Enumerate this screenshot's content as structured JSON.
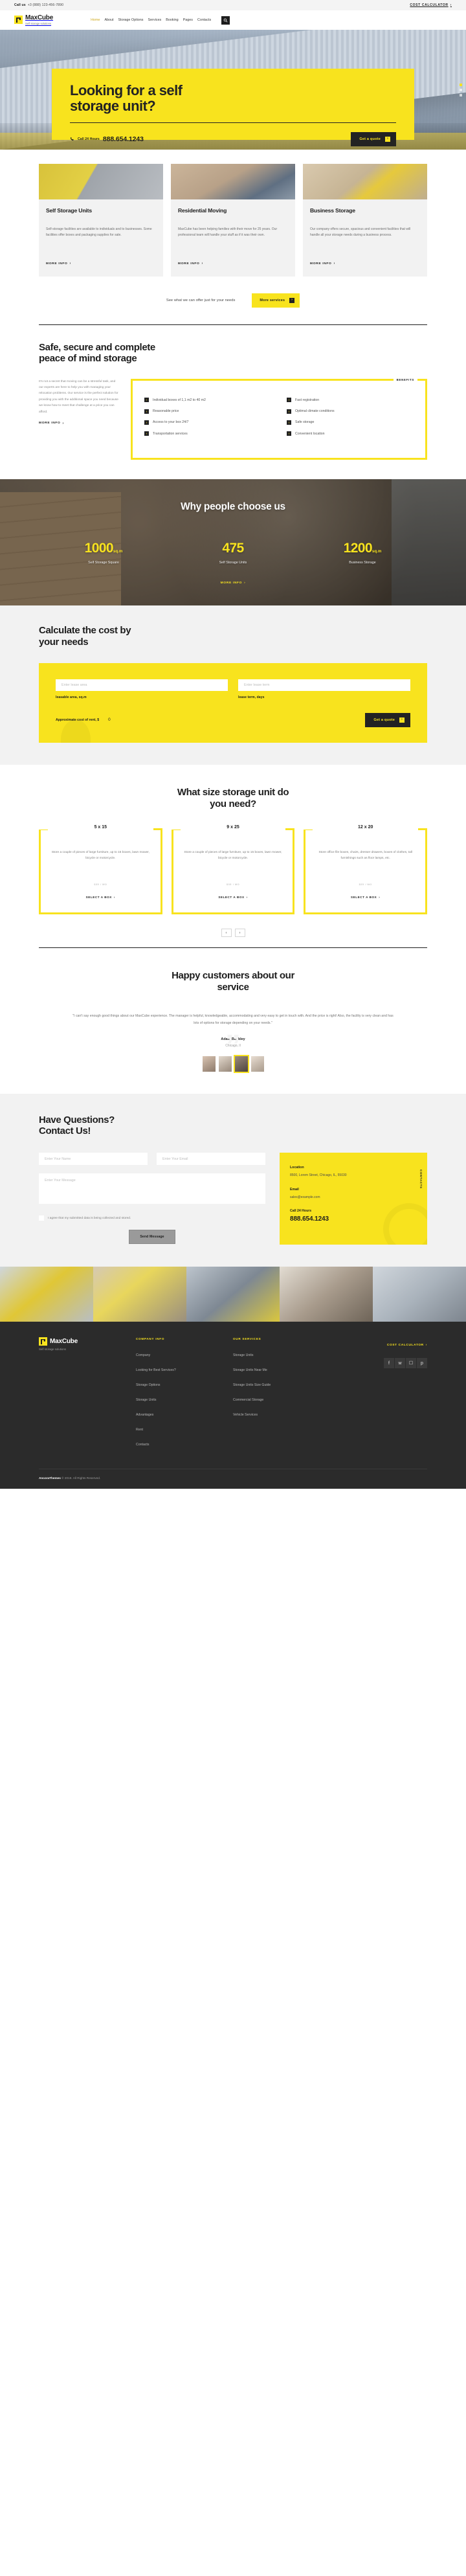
{
  "topbar": {
    "call_label": "Call us",
    "phone": "+3 (888) 123-456-7890",
    "cost_calculator": "COST CALCULATOR",
    "chevron": "›"
  },
  "header": {
    "brand_name": "MaxCube",
    "brand_tagline": "Self storage solutions",
    "nav": [
      {
        "label": "Home",
        "active": true
      },
      {
        "label": "About",
        "active": false
      },
      {
        "label": "Storage Options",
        "active": false
      },
      {
        "label": "Services",
        "active": false
      },
      {
        "label": "Booking",
        "active": false
      },
      {
        "label": "Pages",
        "active": false
      },
      {
        "label": "Contacts",
        "active": false
      }
    ],
    "search_icon": "search-icon"
  },
  "hero": {
    "title_line1": "Looking for a self",
    "title_line2": "storage unit?",
    "call_label": "Call 24 Hours",
    "phone": "888.654.1243",
    "cta": "Get a quote",
    "chevron": "›"
  },
  "services": {
    "cards": [
      {
        "title": "Self Storage Units",
        "text": "Self-storage facilities are available to individuals and to businesses. Some facilities offer boxes and packaging supplies for sale.",
        "link": "MORE INFO"
      },
      {
        "title": "Residential Moving",
        "text": "MaxCube has been helping families with their move for 25 years. Our professional team will handle your stuff as if it was their own.",
        "link": "MORE INFO"
      },
      {
        "title": "Business Storage",
        "text": "Our company offers secure, spacious and convenient facilities that will handle all your storage needs during a business process.",
        "link": "MORE INFO"
      }
    ],
    "offer_text": "See what we can offer just for your needs",
    "offer_cta": "More services",
    "chevron": "›"
  },
  "benefits": {
    "title_line1": "Safe, secure and complete",
    "title_line2": "peace of mind storage",
    "intro": "It's not a secret that moving can be a stressful task, and our experts are here to help you with managing your relocation problems. Our service is the perfect solution for providing you with the additional space you need because we know how to meet that challenge at a price you can afford.",
    "more_link": "MORE INFO",
    "tag": "BENEFITS",
    "column_left": [
      "Individual boxes of 1,1 m2 to 40 m2",
      "Reasonable price",
      "Access to your box 24/7",
      "Transportation services"
    ],
    "column_right": [
      "Fast registration",
      "Optimal climate conditions",
      "Safe storage",
      "Convenient location"
    ],
    "bullet": "›"
  },
  "stats": {
    "title": "Why people choose us",
    "items": [
      {
        "value": "1000",
        "unit": "sq.m",
        "label": "Self Storage Square"
      },
      {
        "value": "475",
        "unit": "",
        "label": "Self Storage Units"
      },
      {
        "value": "1200",
        "unit": "sq.m",
        "label": "Business Storage"
      }
    ],
    "more_link": "MORE INFO",
    "chevron": "›"
  },
  "calculator": {
    "title_line1": "Calculate the cost by",
    "title_line2": "your needs",
    "area_placeholder": "Enter lease area",
    "area_label": "leasable area, sq.m",
    "term_placeholder": "Enter lease term",
    "term_label": "lease term, days",
    "cost_label": "Approximate cost of rent, $",
    "cost_value": "0",
    "cta": "Get a quote",
    "chevron": "›"
  },
  "sizes": {
    "title_line1": "What size storage unit do",
    "title_line2": "you need?",
    "cards": [
      {
        "name": "5 x 15",
        "text": "Store a couple of pieces of large furniture, up to 15 boxes, lawn mower, bicycle or motorcycle.",
        "price": "$35",
        "price_unit": "/ MO",
        "cta": "SELECT A BOX"
      },
      {
        "name": "9 x 25",
        "text": "Store a couple of pieces of large furniture, up to 15 boxes, lawn mower, bicycle or motorcycle.",
        "price": "$35",
        "price_unit": "/ MO",
        "cta": "SELECT A BOX"
      },
      {
        "name": "12 x 20",
        "text": "Store office file boxes, chairs, dresser drawers, boxes of clothes, tall furnishings such as floor lamps, etc.",
        "price": "$35",
        "price_unit": "/ MO",
        "cta": "SELECT A BOX"
      }
    ],
    "prev": "‹",
    "next": "›",
    "chevron": "›"
  },
  "testimonials": {
    "title_line1": "Happy customers about our",
    "title_line2": "service",
    "quote": "\"I can't say enough good things about our MaxCube experience. The manager is helpful, knowledgeable, accommodating and very easy to get in touch with. And the price is right! Also, the facility is very clean and has lots of options for storage depending on your needs.\"",
    "author": "Adam Buckley",
    "city": "Chicago, Il",
    "quote_glyph": "”",
    "avatar_count": 4,
    "active_avatar": 2
  },
  "contact": {
    "title_line1": "Have Questions?",
    "title_line2": "Contact Us!",
    "name_placeholder": "Enter Your Name",
    "email_placeholder": "Enter Your Email",
    "message_placeholder": "Enter Your Message",
    "agree_label": "I agree that my submitted data is being collected and stored.",
    "send_label": "Send Message",
    "card_vertical": "CONTACTS",
    "location_title": "Location",
    "location_value": "8500, Lorem Street, Chicago, IL, 55030",
    "email_title": "Email",
    "email_value": "sales@example.com",
    "phone_title": "Call 24 Hours",
    "phone_value": "888.654.1243"
  },
  "footer": {
    "brand_name": "MaxCube",
    "brand_tagline": "Self storage solutions",
    "company_title": "COMPANY INFO",
    "company_links": [
      "Company",
      "Looking for Best Services?",
      "Storage Options",
      "Storage Units",
      "Advantages",
      "Rent",
      "Contacts"
    ],
    "services_title": "OUR SERVICES",
    "services_links": [
      "Storage Units",
      "Storage Units Near Me",
      "Storage Units Size Guide",
      "Commercial Storage",
      "Vehicle Services"
    ],
    "cost_calculator": "COST CALCULATOR",
    "chevron": "›",
    "social": [
      "facebook-icon",
      "twitter-icon",
      "instagram-icon",
      "pinterest-icon"
    ],
    "copyright_brand": "AncoraThemes",
    "copyright_text": " © 2019. All Rights Reserved."
  },
  "colors": {
    "accent": "#f8e31e",
    "dark": "#232323",
    "footer_bg": "#2b2b2b",
    "muted_bg": "#f2f2f2"
  }
}
